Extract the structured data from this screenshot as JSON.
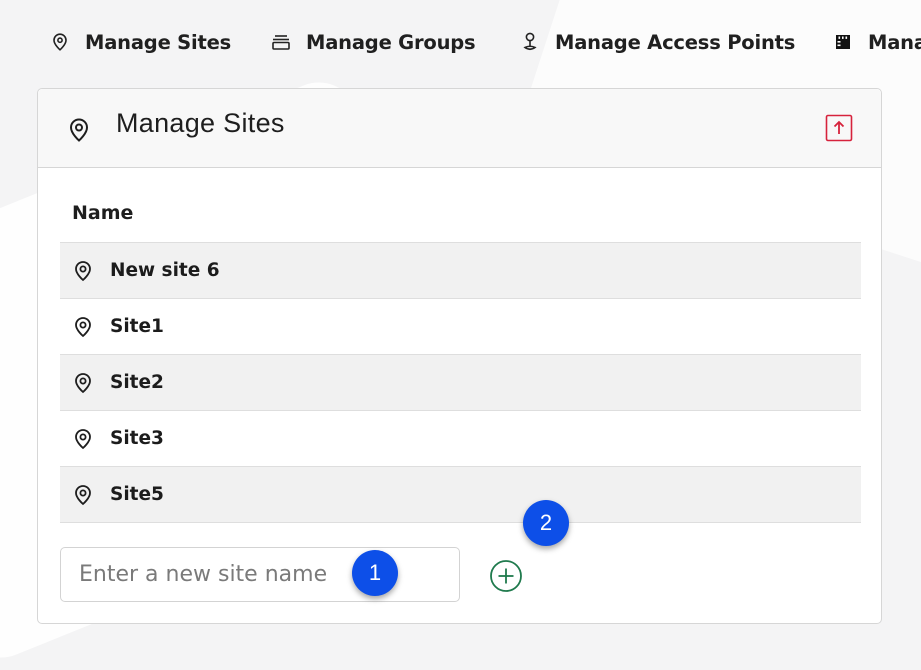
{
  "nav": {
    "items": [
      {
        "label": "Manage Sites",
        "icon": "location-pin-icon"
      },
      {
        "label": "Manage Groups",
        "icon": "layers-icon"
      },
      {
        "label": "Manage Access Points",
        "icon": "access-point-icon"
      },
      {
        "label": "Mana",
        "icon": "film-icon"
      }
    ]
  },
  "panel": {
    "title": "Manage Sites",
    "header_icon": "location-pin-icon",
    "collapse_icon": "arrow-up-square-icon",
    "table": {
      "column": "Name",
      "rows": [
        "New site 6",
        "Site1",
        "Site2",
        "Site3",
        "Site5"
      ]
    },
    "input": {
      "placeholder": "Enter a new site name",
      "value": ""
    },
    "add_icon": "plus-circle-icon"
  },
  "badges": [
    "1",
    "2"
  ],
  "colors": {
    "accent_blue": "#0d4fe8",
    "collapse_red": "#d6223c",
    "add_green": "#1f7a4d"
  }
}
